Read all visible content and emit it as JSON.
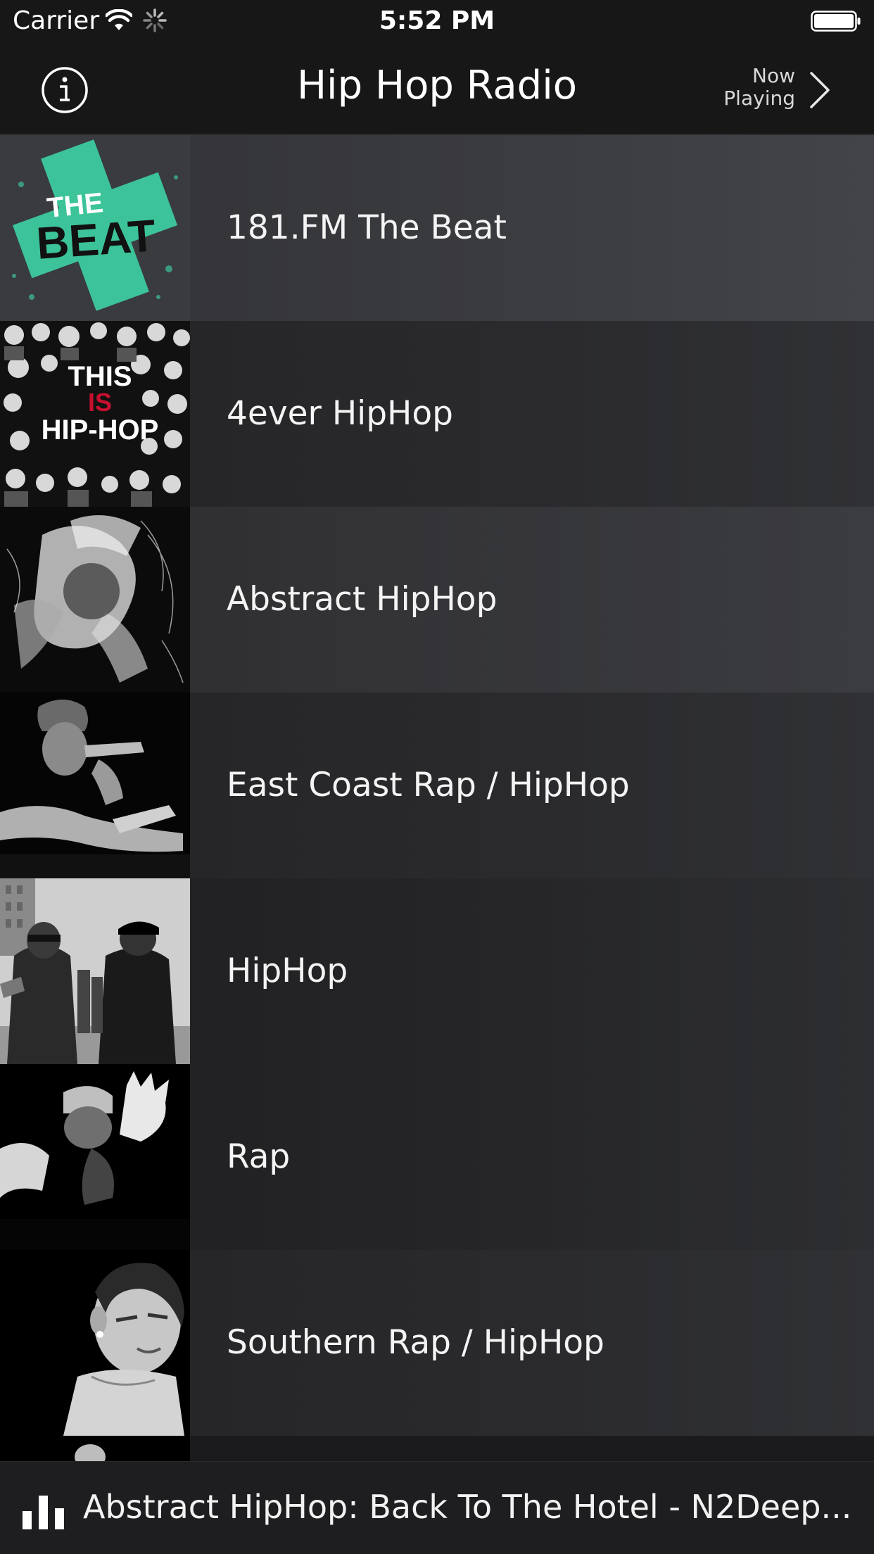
{
  "status_bar": {
    "carrier": "Carrier",
    "time": "5:52 PM",
    "icons": [
      "wifi-icon",
      "activity-spinner-icon",
      "battery-icon"
    ]
  },
  "nav": {
    "title": "Hip Hop Radio",
    "info_icon": "info-icon",
    "now_playing_line1": "Now",
    "now_playing_line2": "Playing",
    "chevron_icon": "chevron-right-icon"
  },
  "stations": [
    {
      "name": "181.FM The Beat",
      "selected": true
    },
    {
      "name": "4ever HipHop",
      "selected": false
    },
    {
      "name": "Abstract HipHop",
      "selected": false
    },
    {
      "name": "East Coast Rap / HipHop",
      "selected": false
    },
    {
      "name": "HipHop",
      "selected": false
    },
    {
      "name": "Rap",
      "selected": false
    },
    {
      "name": "Southern Rap / HipHop",
      "selected": false
    }
  ],
  "artwork_text": {
    "the_beat_line1": "THE",
    "the_beat_line2": "BEAT",
    "this_is_line1": "THIS",
    "this_is_line2": "IS",
    "this_is_line3": "HIP-HOP"
  },
  "mini_player": {
    "icon": "equalizer-bars-icon",
    "text": "Abstract HipHop: Back To The Hotel - N2Deep..."
  },
  "colors": {
    "background": "#1d1d1f",
    "nav_background": "#171717",
    "text": "#ffffff",
    "beat_accent": "#3cc39a",
    "hiphop_red": "#c8102e"
  }
}
